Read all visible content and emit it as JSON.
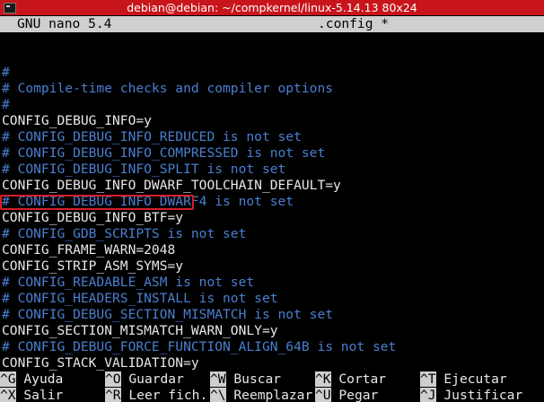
{
  "window": {
    "title": "debian@debian: ~/compkernel/linux-5.14.13 80x24",
    "icon": "terminal-icon"
  },
  "nano": {
    "version": "GNU nano 5.4",
    "filename": ".config *"
  },
  "lines": [
    {
      "text": "",
      "kind": "code"
    },
    {
      "text": "#",
      "kind": "comment"
    },
    {
      "text": "# Compile-time checks and compiler options",
      "kind": "comment"
    },
    {
      "text": "#",
      "kind": "comment"
    },
    {
      "text": "CONFIG_DEBUG_INFO=y",
      "kind": "code"
    },
    {
      "text": "# CONFIG_DEBUG_INFO_REDUCED is not set",
      "kind": "comment"
    },
    {
      "text": "# CONFIG_DEBUG_INFO_COMPRESSED is not set",
      "kind": "comment"
    },
    {
      "text": "# CONFIG_DEBUG_INFO_SPLIT is not set",
      "kind": "comment"
    },
    {
      "text": "CONFIG_DEBUG_INFO_DWARF_TOOLCHAIN_DEFAULT=y",
      "kind": "code"
    },
    {
      "text": "# CONFIG_DEBUG_INFO_DWARF4 is not set",
      "kind": "comment"
    },
    {
      "text": "CONFIG_DEBUG_INFO_BTF=y",
      "kind": "code"
    },
    {
      "text": "# CONFIG_GDB_SCRIPTS is not set",
      "kind": "comment"
    },
    {
      "text": "CONFIG_FRAME_WARN=2048",
      "kind": "code"
    },
    {
      "text": "CONFIG_STRIP_ASM_SYMS=y",
      "kind": "code"
    },
    {
      "text": "# CONFIG_READABLE_ASM is not set",
      "kind": "comment"
    },
    {
      "text": "# CONFIG_HEADERS_INSTALL is not set",
      "kind": "comment"
    },
    {
      "text": "# CONFIG_DEBUG_SECTION_MISMATCH is not set",
      "kind": "comment"
    },
    {
      "text": "CONFIG_SECTION_MISMATCH_WARN_ONLY=y",
      "kind": "code"
    },
    {
      "text": "# CONFIG_DEBUG_FORCE_FUNCTION_ALIGN_64B is not set",
      "kind": "comment"
    },
    {
      "text": "CONFIG_STACK_VALIDATION=y",
      "kind": "code"
    }
  ],
  "shortcuts": {
    "row1": [
      {
        "key": "^G",
        "label": "Ayuda"
      },
      {
        "key": "^O",
        "label": "Guardar"
      },
      {
        "key": "^W",
        "label": "Buscar"
      },
      {
        "key": "^K",
        "label": "Cortar"
      },
      {
        "key": "^T",
        "label": "Ejecutar"
      }
    ],
    "row2": [
      {
        "key": "^X",
        "label": "Salir"
      },
      {
        "key": "^R",
        "label": "Leer fich."
      },
      {
        "key": "^\\",
        "label": "Reemplazar"
      },
      {
        "key": "^U",
        "label": "Pegar"
      },
      {
        "key": "^J",
        "label": "Justificar"
      }
    ]
  },
  "colors": {
    "titlebar": "#c8151b",
    "header_bg": "#cfcfcf",
    "comment": "#4a7fd0",
    "text": "#e8e8e8",
    "highlight_box": "#d81e25",
    "background": "#000000"
  }
}
